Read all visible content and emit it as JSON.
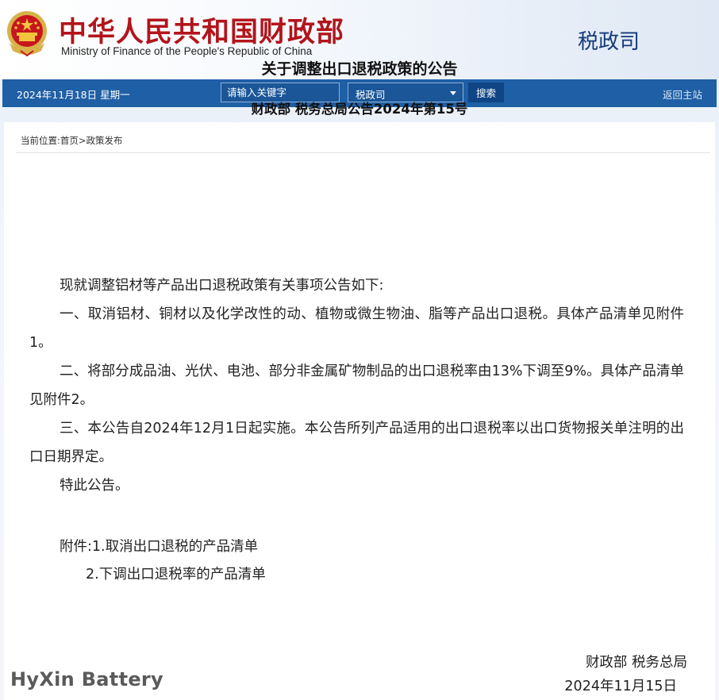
{
  "header": {
    "site_name_cn": "中华人民共和国财政部",
    "site_name_en": "Ministry of Finance of the People's Republic of China",
    "department": "税政司"
  },
  "navbar": {
    "date": "2024年11月18日  星期一",
    "search_placeholder": "请输入关键字",
    "department_select": "税政司",
    "search_button": "搜索",
    "home_link": "返回主站"
  },
  "breadcrumb": {
    "label": "当前位置:",
    "home": "首页",
    "separator": ">",
    "current": "政策发布"
  },
  "article": {
    "title": "关于调整出口退税政策的公告",
    "subtitle": "财政部 税务总局公告2024年第15号",
    "paragraphs": [
      "现就调整铝材等产品出口退税政策有关事项公告如下:",
      "一、取消铝材、铜材以及化学改性的动、植物或微生物油、脂等产品出口退税。具体产品清单见附件1。",
      "二、将部分成品油、光伏、电池、部分非金属矿物制品的出口退税率由13%下调至9%。具体产品清单见附件2。",
      "三、本公告自2024年12月1日起实施。本公告所列产品适用的出口退税率以出口货物报关单注明的出口日期界定。",
      "特此公告。"
    ],
    "attachments_label": "附件:",
    "attachments": [
      "1.取消出口退税的产品清单",
      "2.下调出口退税率的产品清单"
    ],
    "signer": "财政部  税务总局",
    "date": "2024年11月15日"
  },
  "watermark": "HyXin Battery",
  "colors": {
    "brand_red": "#b2151b",
    "navbar_blue": "#1f5fa5",
    "dept_blue": "#143a78"
  }
}
